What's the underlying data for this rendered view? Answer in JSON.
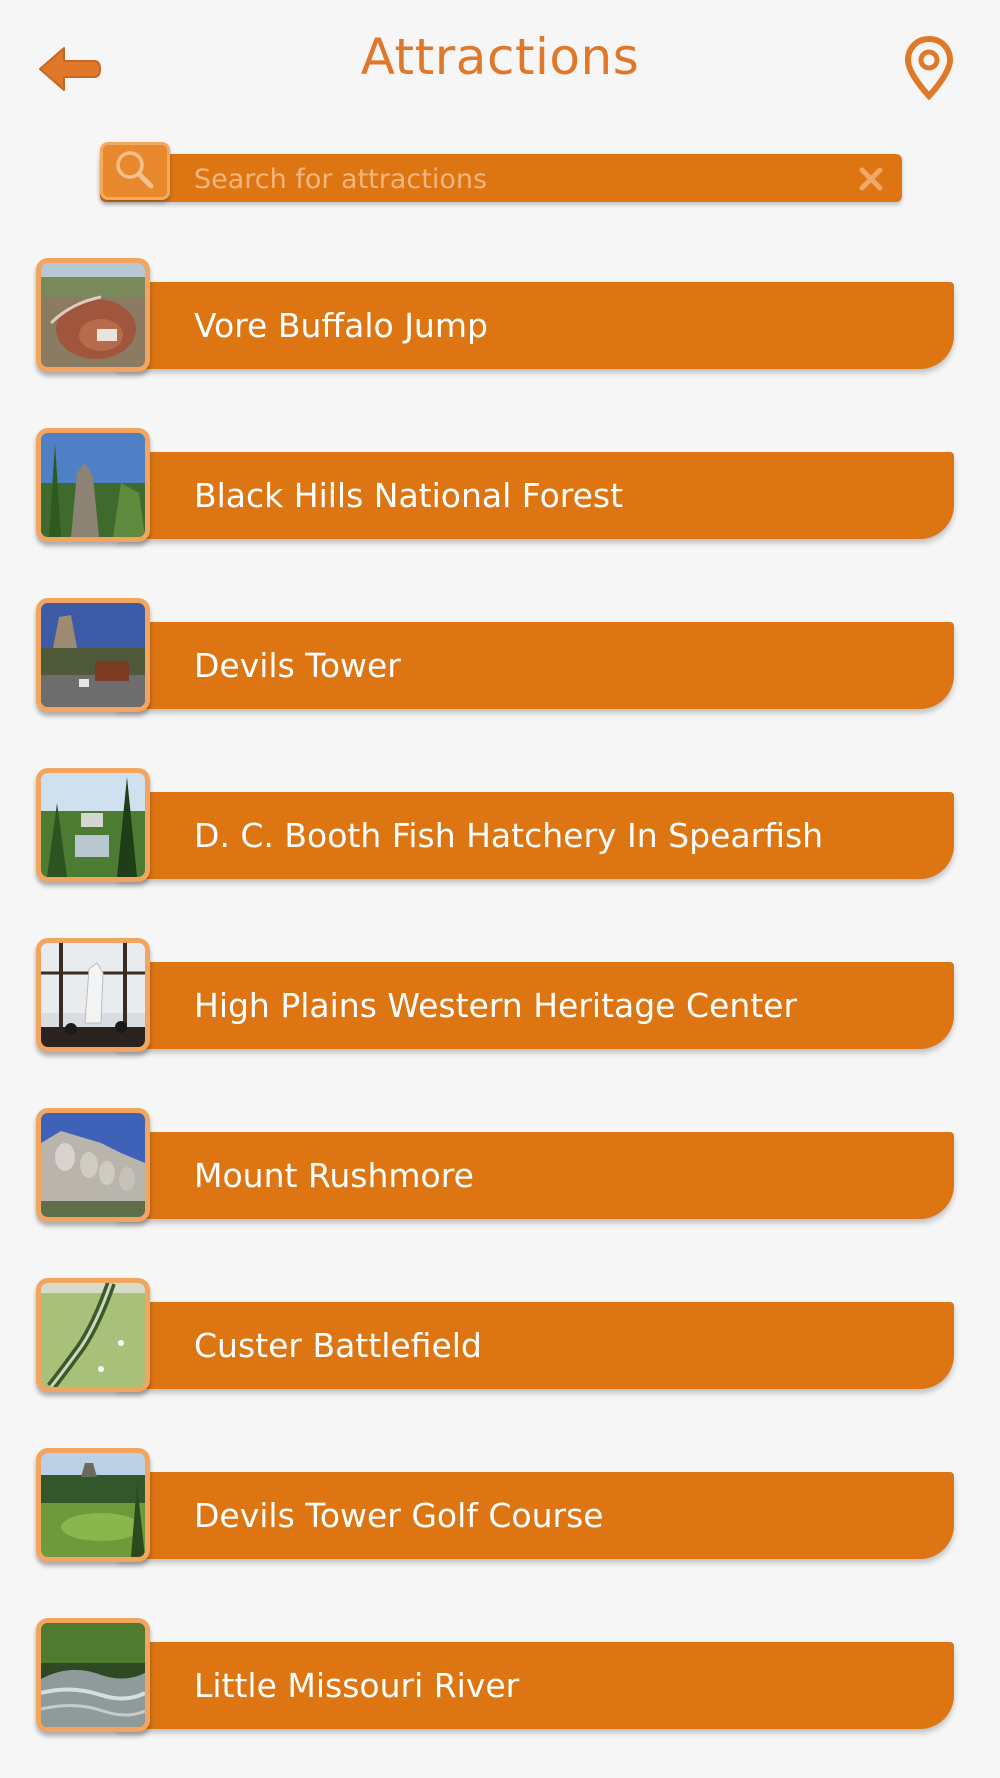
{
  "header": {
    "title": "Attractions",
    "back_icon": "arrow-left-icon",
    "map_icon": "map-pin-icon",
    "accent_color": "#e0782a"
  },
  "search": {
    "placeholder": "Search for attractions",
    "value": "",
    "search_icon": "magnifier-icon",
    "clear_icon": "close-icon"
  },
  "attractions": [
    {
      "label": "Vore Buffalo Jump"
    },
    {
      "label": "Black Hills National Forest"
    },
    {
      "label": "Devils Tower"
    },
    {
      "label": "D. C. Booth Fish Hatchery In Spearfish"
    },
    {
      "label": "High Plains Western Heritage Center"
    },
    {
      "label": "Mount Rushmore"
    },
    {
      "label": "Custer Battlefield"
    },
    {
      "label": "Devils Tower Golf Course"
    },
    {
      "label": "Little Missouri River"
    }
  ],
  "colors": {
    "bar": "#dd7512",
    "thumb_border": "#f2a55e",
    "background": "#f6f6f7",
    "text": "#ffffff"
  }
}
